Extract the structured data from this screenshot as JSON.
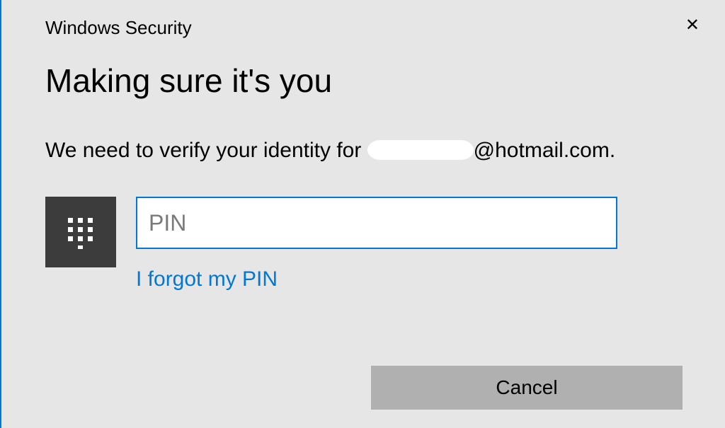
{
  "window": {
    "title": "Windows Security"
  },
  "dialog": {
    "heading": "Making sure it's you",
    "message_prefix": "We need to verify your identity for ",
    "message_suffix": "@hotmail.com."
  },
  "pin": {
    "placeholder": "PIN",
    "value": "",
    "forgot_label": "I forgot my PIN"
  },
  "buttons": {
    "cancel_label": "Cancel"
  },
  "icons": {
    "close": "✕",
    "pin_keypad": "keypad-icon"
  },
  "colors": {
    "accent": "#0078d4",
    "icon_bg": "#3c3c3c",
    "dialog_bg": "#e6e6e6",
    "button_bg": "#b0b0b0"
  }
}
